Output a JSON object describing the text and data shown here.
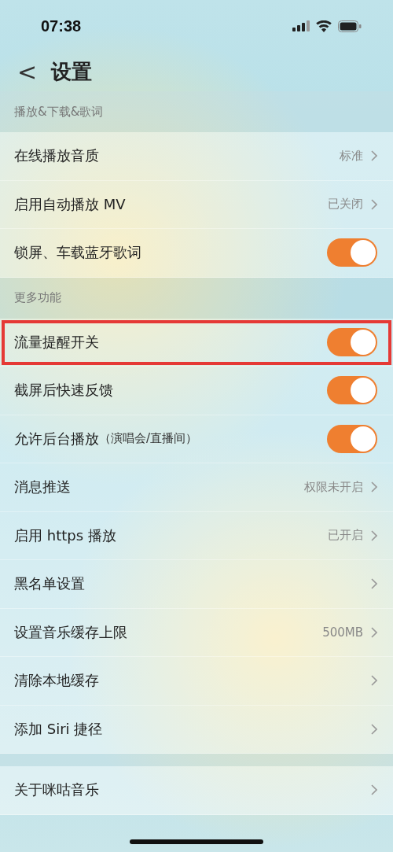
{
  "status_bar": {
    "time": "07:38"
  },
  "header": {
    "back": "<",
    "title": "设置"
  },
  "sections": [
    {
      "title": "播放&下载&歌词",
      "items": [
        {
          "kind": "value",
          "label": "在线播放音质",
          "value": "标准",
          "highlighted": false
        },
        {
          "kind": "value",
          "label": "启用自动播放 MV",
          "value": "已关闭",
          "highlighted": false
        },
        {
          "kind": "toggle",
          "label": "锁屏、车载蓝牙歌词",
          "on": true,
          "highlighted": false
        }
      ]
    },
    {
      "title": "更多功能",
      "items": [
        {
          "kind": "toggle",
          "label": "流量提醒开关",
          "on": true,
          "highlighted": true
        },
        {
          "kind": "toggle",
          "label": "截屏后快速反馈",
          "on": true,
          "highlighted": false
        },
        {
          "kind": "toggle",
          "label": "允许后台播放",
          "note": "（演唱会/直播间）",
          "on": true,
          "highlighted": false
        },
        {
          "kind": "value",
          "label": "消息推送",
          "value": "权限未开启",
          "highlighted": false
        },
        {
          "kind": "value",
          "label": "启用 https 播放",
          "value": "已开启",
          "highlighted": false
        },
        {
          "kind": "value",
          "label": "黑名单设置",
          "highlighted": false
        },
        {
          "kind": "value",
          "label": "设置音乐缓存上限",
          "value": "500MB",
          "highlighted": false
        },
        {
          "kind": "value",
          "label": "清除本地缓存",
          "highlighted": false
        },
        {
          "kind": "value",
          "label": "添加 Siri 捷径",
          "highlighted": false
        }
      ]
    },
    {
      "items": [
        {
          "kind": "value",
          "label": "关于咪咕音乐",
          "highlighted": false
        }
      ]
    }
  ]
}
